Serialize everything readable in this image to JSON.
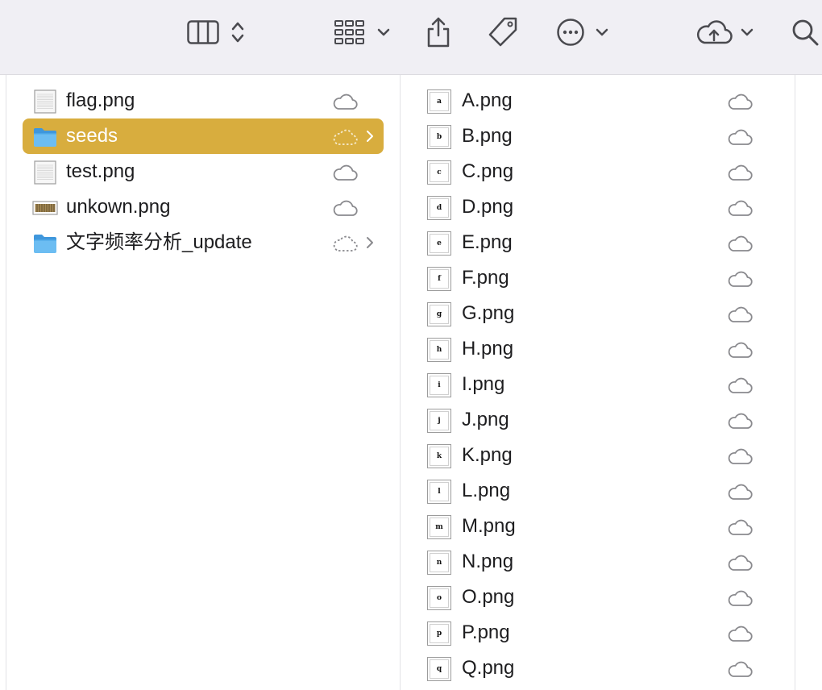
{
  "toolbar": {
    "icons": [
      "column-view-icon",
      "up-down-chevron-icon",
      "grid-view-icon",
      "chevron-down-icon",
      "share-icon",
      "tag-icon",
      "more-icon",
      "chevron-down-icon",
      "icloud-upload-icon",
      "chevron-down-icon",
      "search-icon"
    ]
  },
  "column1": {
    "items": [
      {
        "name": "flag.png",
        "kind": "image",
        "selected": false
      },
      {
        "name": "seeds",
        "kind": "folder",
        "selected": true
      },
      {
        "name": "test.png",
        "kind": "image",
        "selected": false
      },
      {
        "name": "unkown.png",
        "kind": "image-striped",
        "selected": false
      },
      {
        "name": "文字频率分析_update",
        "kind": "folder",
        "selected": false
      }
    ]
  },
  "column2": {
    "items": [
      {
        "name": "A.png",
        "glyph": "a"
      },
      {
        "name": "B.png",
        "glyph": "b"
      },
      {
        "name": "C.png",
        "glyph": "c"
      },
      {
        "name": "D.png",
        "glyph": "d"
      },
      {
        "name": "E.png",
        "glyph": "e"
      },
      {
        "name": "F.png",
        "glyph": "f"
      },
      {
        "name": "G.png",
        "glyph": "g"
      },
      {
        "name": "H.png",
        "glyph": "h"
      },
      {
        "name": "I.png",
        "glyph": "i"
      },
      {
        "name": "J.png",
        "glyph": "j"
      },
      {
        "name": "K.png",
        "glyph": "k"
      },
      {
        "name": "L.png",
        "glyph": "l"
      },
      {
        "name": "M.png",
        "glyph": "m"
      },
      {
        "name": "N.png",
        "glyph": "n"
      },
      {
        "name": "O.png",
        "glyph": "o"
      },
      {
        "name": "P.png",
        "glyph": "p"
      },
      {
        "name": "Q.png",
        "glyph": "q"
      }
    ]
  },
  "colors": {
    "selection": "#d8ad3e",
    "folder": "#5aaee8",
    "icon_stroke": "#4a4a4f",
    "cloud_stroke": "#8a8a8e"
  }
}
